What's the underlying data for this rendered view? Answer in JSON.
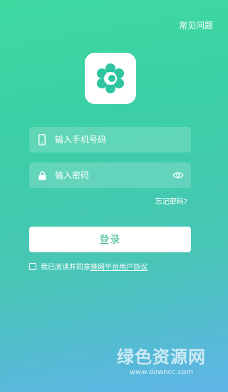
{
  "header": {
    "faq_label": "常见问题"
  },
  "logo": {
    "icon": "flower-logo-icon",
    "color": "#2ec5a0"
  },
  "login_form": {
    "phone_placeholder": "输入手机号码",
    "password_placeholder": "输入密码",
    "forgot_label": "忘记密码?",
    "submit_label": "登录"
  },
  "agreement": {
    "prefix": "我已阅读并同意",
    "link_label": "蜂网平台用户协议"
  },
  "watermark": {
    "title": "绿色资源网",
    "url": "www.downcc.com"
  }
}
